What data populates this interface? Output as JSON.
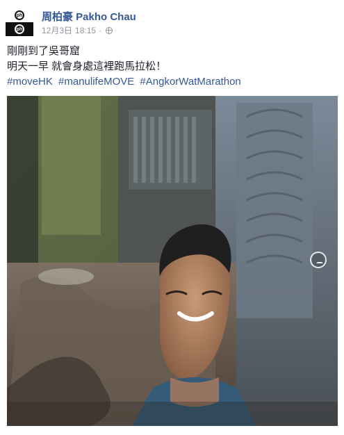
{
  "post": {
    "author": "周柏豪 Pakho Chau",
    "date": "12月3日",
    "time": "18:15",
    "separator": "·",
    "avatar_text": "ph",
    "lines": [
      "剛剛到了吳哥窟",
      "明天一早 就會身處這裡跑馬拉松！"
    ],
    "hashtags": [
      "#moveHK",
      "#manulifeMOVE",
      "#AngkorWatMarathon"
    ]
  },
  "icons": {
    "privacy": "globe-icon",
    "photo_overlay": "360-pano-icon"
  },
  "colors": {
    "link": "#365899",
    "text": "#1d2129",
    "meta": "#90949c"
  }
}
